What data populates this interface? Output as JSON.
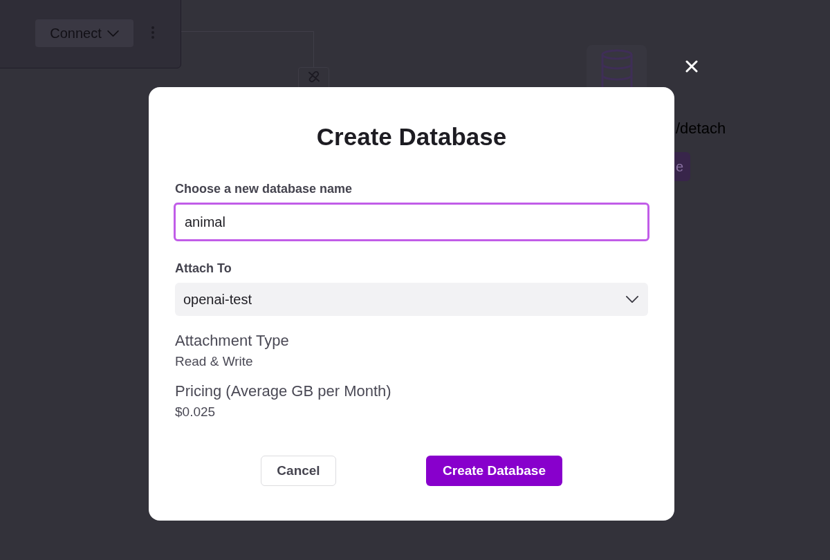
{
  "background": {
    "connect_button": {
      "label": "Connect"
    },
    "detach_label": "/detach",
    "button_fragment": {
      "label": "e"
    }
  },
  "dialog": {
    "title": "Create Database",
    "fields": [
      {
        "kind": "input",
        "label": "Choose a new database name",
        "value": "animal",
        "focused": true
      },
      {
        "kind": "select",
        "label": "Attach To",
        "value": "openai-test",
        "focused": false
      }
    ],
    "details": [
      {
        "label": "Attachment Type",
        "value": "Read & Write"
      },
      {
        "label": "Pricing (Average GB per Month)",
        "value": "$0.025"
      }
    ],
    "buttons": [
      {
        "label": "Cancel",
        "kind": "secondary"
      },
      {
        "label": "Create Database",
        "kind": "primary"
      }
    ]
  }
}
